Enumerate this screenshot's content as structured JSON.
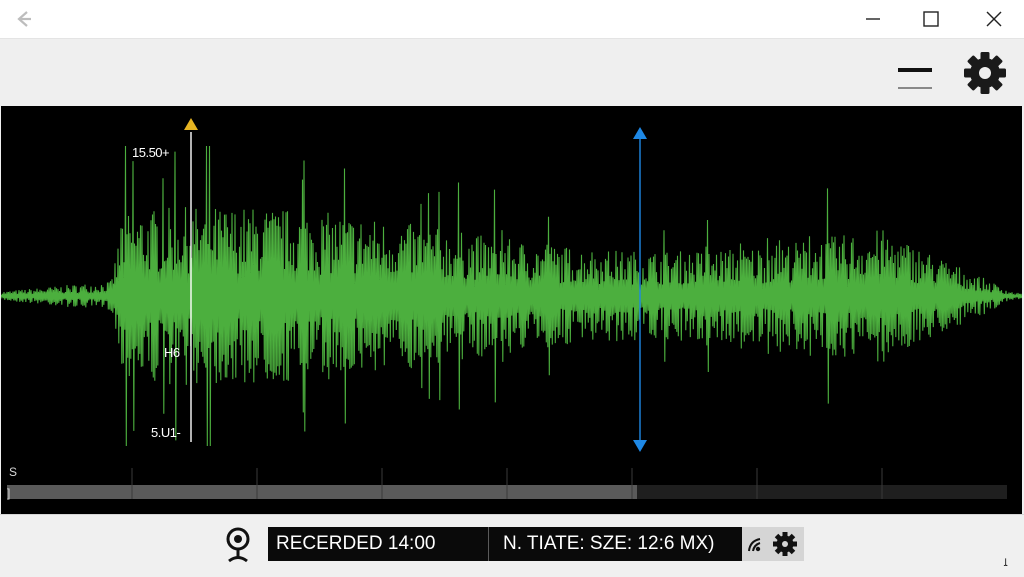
{
  "window": {
    "back_icon": "back-arrow-icon",
    "controls": [
      "minimize-icon",
      "maximize-icon",
      "close-icon"
    ]
  },
  "toolbar": {
    "menu_icon": "menu-icon",
    "settings_icon": "gear-icon"
  },
  "waveform": {
    "color": "#4caf3e",
    "marker_colors": {
      "start": "#e6b422",
      "playhead": "#1e88e5"
    },
    "y_labels": {
      "top": "15.50+",
      "mid": "H6",
      "bottom": "5.U1-"
    },
    "timeline": {
      "label_top": "S",
      "label_bottom": "]",
      "progress": 0.63
    }
  },
  "status": {
    "recorded": "RECERDED 14:00",
    "info": "N. TIATE: SZE: 12:6 MX)",
    "mic_icon": "microphone-icon",
    "extra_icons": [
      "signal-icon",
      "gear-icon"
    ]
  },
  "corner_text": "ﻠ"
}
